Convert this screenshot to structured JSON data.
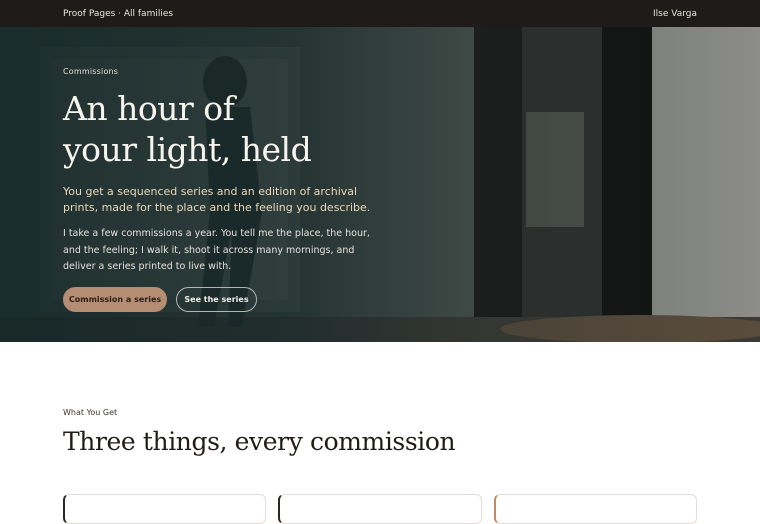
{
  "header": {
    "brand": "Proof Pages · All families",
    "user": "Ilse Varga"
  },
  "hero": {
    "eyebrow": "Commissions",
    "title_line1": "An hour of",
    "title_line2": "your light, held",
    "lede": "You get a sequenced series and an edition of archival prints, made for the place and the feeling you describe.",
    "body": "I take a few commissions a year. You tell me the place, the hour, and the feeling; I walk it, shoot it across many mornings, and deliver a series printed to live with.",
    "primary_button": "Commission a series",
    "secondary_button": "See the series",
    "image_description_icon": "gallery-photo"
  },
  "section": {
    "eyebrow": "What You Get",
    "title": "Three things, every commission"
  },
  "colors": {
    "topbar": "#1e1b18",
    "accent": "#b48d72",
    "hero_tint": "#1b2d2d"
  }
}
